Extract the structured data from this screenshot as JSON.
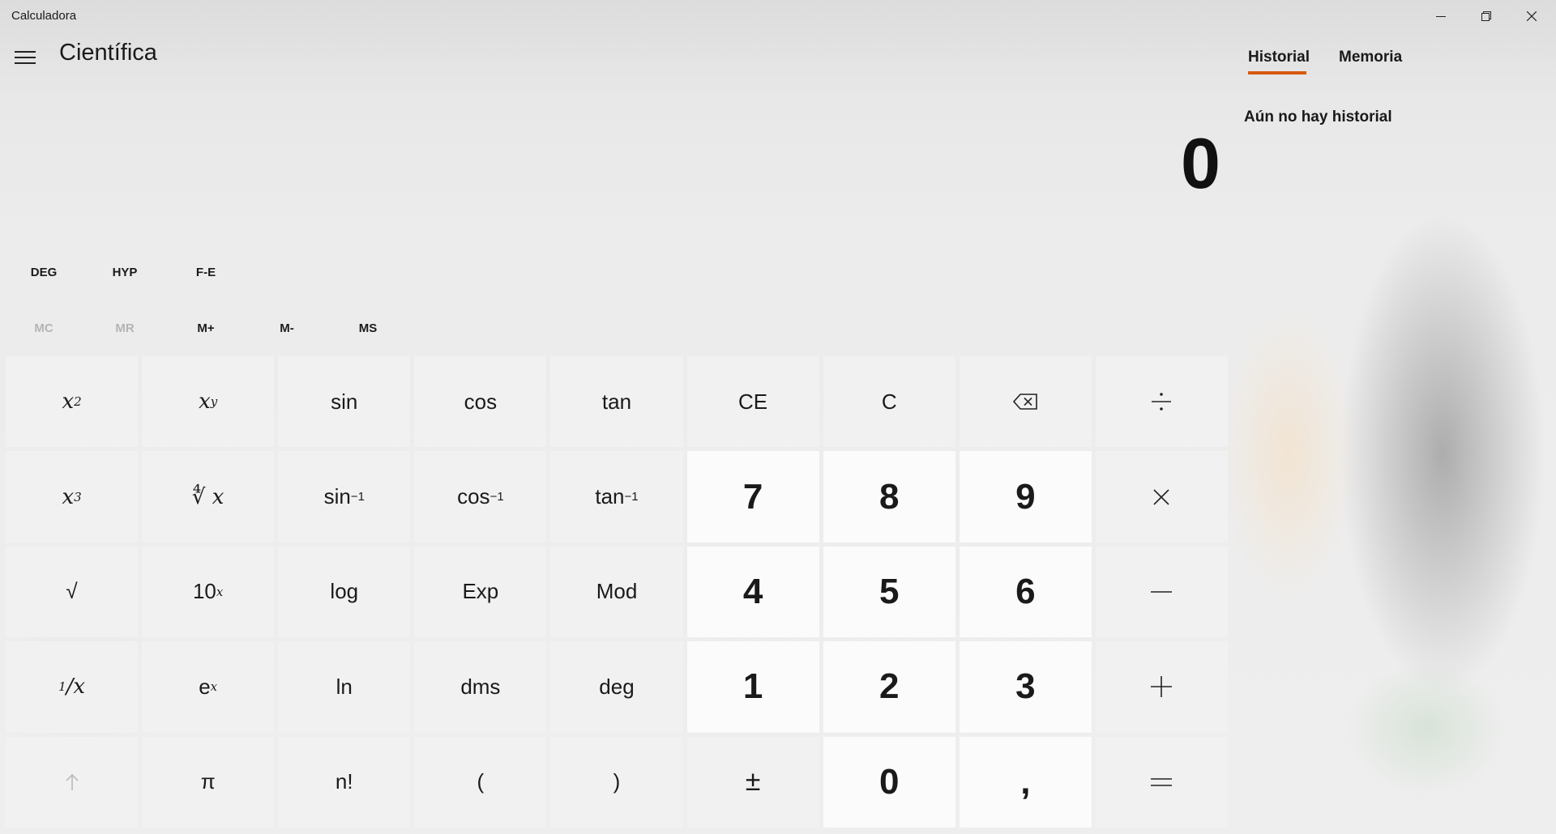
{
  "window": {
    "title": "Calculadora",
    "controls": {
      "minimize_icon": "minimize-icon",
      "maximize_icon": "restore-icon",
      "close_icon": "close-icon"
    }
  },
  "header": {
    "menu_icon": "hamburger-icon",
    "mode_title": "Científica"
  },
  "display": {
    "value": "0"
  },
  "mode_buttons": [
    {
      "label": "DEG"
    },
    {
      "label": "HYP"
    },
    {
      "label": "F-E"
    }
  ],
  "memory_buttons": [
    {
      "label": "MC",
      "enabled": false
    },
    {
      "label": "MR",
      "enabled": false
    },
    {
      "label": "M+",
      "enabled": true
    },
    {
      "label": "M-",
      "enabled": true
    },
    {
      "label": "MS",
      "enabled": true
    }
  ],
  "keypad": {
    "row1": {
      "c3": "sin",
      "c4": "cos",
      "c5": "tan",
      "c6": "CE",
      "c7": "C",
      "backspace_icon": "backspace-icon",
      "divide_icon": "divide-icon"
    },
    "row2": {
      "c3_base": "sin",
      "c3_sup": "−1",
      "c4_base": "cos",
      "c4_sup": "−1",
      "c5_base": "tan",
      "c5_sup": "−1",
      "c6": "7",
      "c7": "8",
      "c8": "9",
      "multiply_icon": "multiply-icon"
    },
    "row3": {
      "c1": "√",
      "c2_base": "10",
      "c2_sup": "x",
      "c3": "log",
      "c4": "Exp",
      "c5": "Mod",
      "c6": "4",
      "c7": "5",
      "c8": "6",
      "minus_icon": "minus-icon"
    },
    "row4": {
      "c1_sup": "1",
      "c1_base": "/x",
      "c2_base": "e",
      "c2_sup": "x",
      "c3": "ln",
      "c4": "dms",
      "c5": "deg",
      "c6": "1",
      "c7": "2",
      "c8": "3",
      "plus_icon": "plus-icon"
    },
    "row5": {
      "shift_icon": "up-arrow-icon",
      "c2": "π",
      "c3": "n!",
      "c4": "(",
      "c5": ")",
      "c6": "±",
      "c7": "0",
      "c8": ",",
      "equals_icon": "equals-icon"
    },
    "row1_fn": {
      "c1_base": "x",
      "c1_sup": "2",
      "c2_base": "x",
      "c2_sup": "y"
    },
    "row2_fn": {
      "c1_base": "x",
      "c1_sup": "3",
      "c2_root": "∜",
      "c2_x": "x",
      "c2_index": "y"
    }
  },
  "side_panel": {
    "tabs": [
      {
        "label": "Historial",
        "active": true
      },
      {
        "label": "Memoria",
        "active": false
      }
    ],
    "empty_message": "Aún no hay historial",
    "accent_color": "#d65a0f"
  }
}
